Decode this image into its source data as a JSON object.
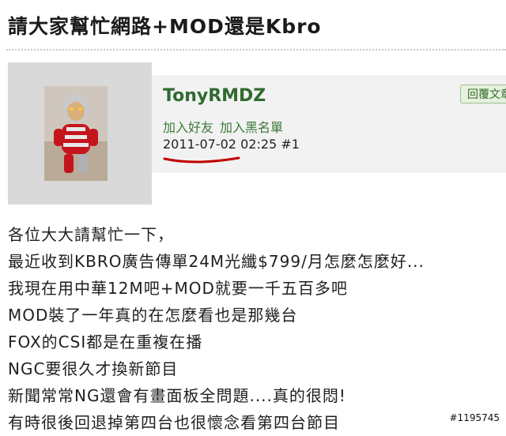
{
  "page": {
    "title": "請大家幫忙網路+MOD還是Kbro"
  },
  "post": {
    "username": "TonyRMDZ",
    "reply_label": "回覆文章",
    "add_friend": "加入好友",
    "add_blacklist": "加入黑名單",
    "date": "2011-07-02",
    "time": "02:25",
    "floor": "#1",
    "annotation_color": "#c00000"
  },
  "body": {
    "lines": [
      "各位大大請幫忙一下，",
      "最近收到KBRO廣告傳單24M光纖$799/月怎麼怎麼好...",
      "我現在用中華12M吧+MOD就要一千五百多吧",
      "MOD裝了一年真的在怎麼看也是那幾台",
      "FOX的CSI都是在重複在播",
      "NGC要很久才換新節目",
      "新聞常常NG還會有畫面板全問題....真的很悶!",
      "有時很後回退掉第四台也很懷念看第四台節目"
    ]
  },
  "watermark": "#1195745"
}
